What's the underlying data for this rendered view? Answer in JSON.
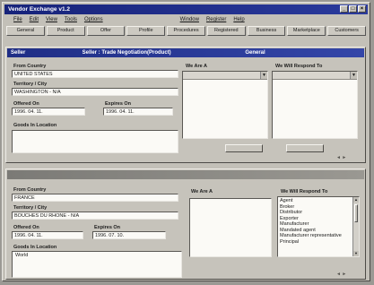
{
  "app": {
    "title": "Vendor Exchange v1.2"
  },
  "menu": {
    "items": [
      "File",
      "Edit",
      "View",
      "Tools",
      "Options",
      "Window",
      "Register",
      "Help"
    ]
  },
  "toolbar": {
    "buttons": [
      "General",
      "Product",
      "Offer",
      "Profile",
      "Procedures",
      "Registered",
      "Business",
      "Marketplace",
      "Customers"
    ]
  },
  "window1": {
    "title_left": "Seller",
    "title_mid": "Seller : Trade Negotiation(Product)",
    "title_right": "General",
    "from_country_label": "From Country",
    "from_country_value": "UNITED STATES",
    "territory_label": "Territory / City",
    "territory_value": "WASHINGTON - N/A",
    "offered_on_label": "Offered On",
    "offered_on_value": "1996. 04. 11.",
    "expires_on_label": "Expires On",
    "expires_on_value": "1996. 04. 11.",
    "goods_location_label": "Goods In Location",
    "we_are_label": "We Are A",
    "we_will_respond_label": "We Will Respond To"
  },
  "window2": {
    "from_country_label": "From Country",
    "from_country_value": "FRANCE",
    "territory_label": "Territory / City",
    "territory_value": "BOUCHES DU RHONE - N/A",
    "offered_on_label": "Offered On",
    "offered_on_value": "1996. 04. 11.",
    "expires_on_label": "Expires On",
    "expires_on_value": "1996. 07. 10.",
    "goods_location_label": "Goods In Location",
    "goods_location_value": "World",
    "we_are_label": "We Are A",
    "we_will_respond_label": "We Will Respond To",
    "respond_options": [
      "Agent",
      "Broker",
      "Distributor",
      "Exporter",
      "Manufacturer",
      "Mandated agent",
      "Manufacturer representative",
      "Principal"
    ]
  }
}
